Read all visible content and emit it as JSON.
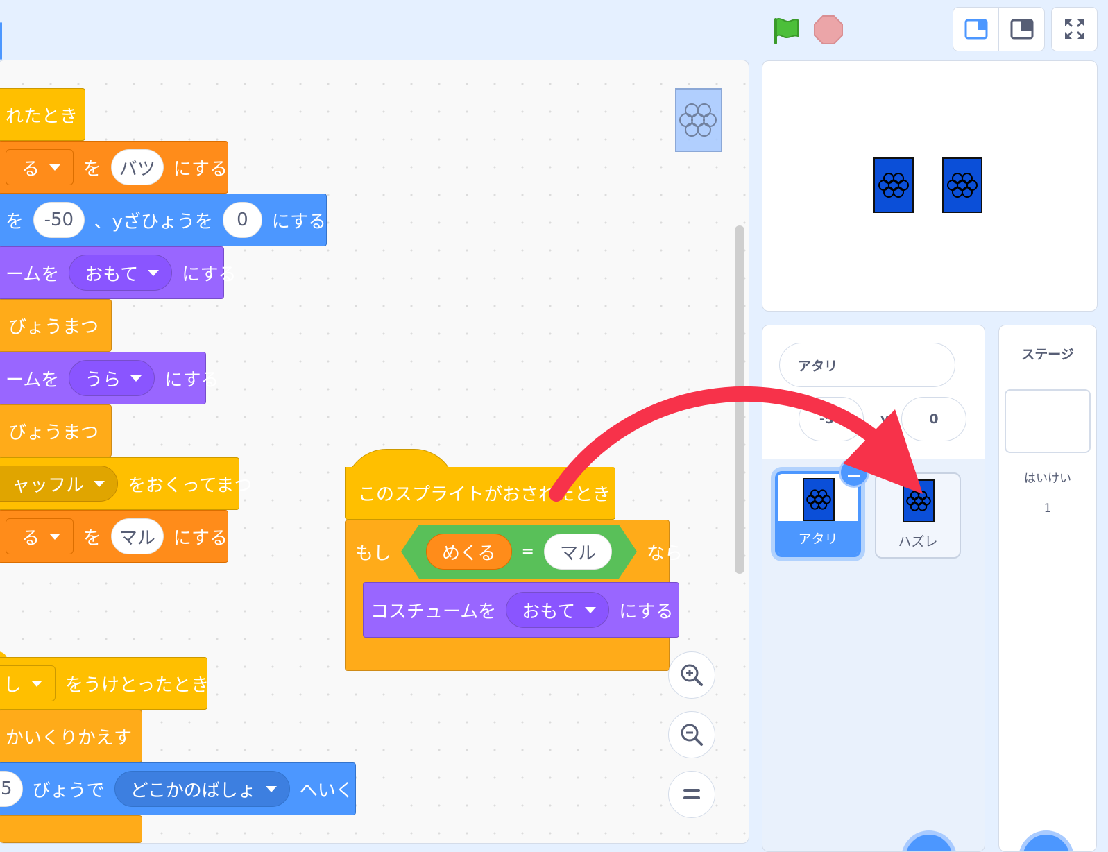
{
  "topbar": {
    "green_flag_icon": "green-flag-icon",
    "stop_icon": "stop-icon",
    "layout_buttons": [
      "small-stage-icon",
      "large-stage-icon"
    ],
    "fullscreen_icon": "fullscreen-icon"
  },
  "scripts": {
    "s1_hat": "れたとき",
    "s1_set1_dd": "る",
    "s1_set1_wo": "を",
    "s1_set1_val": "バツ",
    "s1_set1_suffix": "にする",
    "s1_goto_prefix": "を",
    "s1_goto_x": "-50",
    "s1_goto_mid": "、yざひょうを",
    "s1_goto_y": "0",
    "s1_goto_suffix": "にする",
    "s1_costume1_prefix": "ームを",
    "s1_costume1_dd": "おもて",
    "s1_costume1_suffix": "にする",
    "s1_wait1": "びょうまつ",
    "s1_costume2_prefix": "ームを",
    "s1_costume2_dd": "うら",
    "s1_costume2_suffix": "にする",
    "s1_wait2": "びょうまつ",
    "s1_broadcast_dd": "ャッフル",
    "s1_broadcast_suffix": "をおくってまつ",
    "s1_set2_dd": "る",
    "s1_set2_wo": "を",
    "s1_set2_val": "マル",
    "s1_set2_suffix": "にする",
    "s2_hat_dd": "し",
    "s2_hat_suffix": "をうけとったとき",
    "s2_repeat": "かいくりかえす",
    "s2_glide_val": "5",
    "s2_glide_mid": "びょうで",
    "s2_glide_dd": "どこかのばしょ",
    "s2_glide_suffix": "へいく",
    "s3_hat": "このスプライトがおされたとき",
    "s3_if": "もし",
    "s3_var": "めくる",
    "s3_eq": "=",
    "s3_val": "マル",
    "s3_then": "なら",
    "s3_costume_prefix": "コスチュームを",
    "s3_costume_dd": "おもて",
    "s3_costume_suffix": "にする"
  },
  "zoom": [
    "zoom-in-icon",
    "zoom-out-icon",
    "zoom-reset-icon"
  ],
  "sprite_info": {
    "name": "アタリ",
    "x": "-50",
    "y_label": "y",
    "y": "0"
  },
  "sprites": [
    {
      "name": "アタリ",
      "selected": true
    },
    {
      "name": "ハズレ",
      "selected": false
    }
  ],
  "stage_panel": {
    "title": "ステージ",
    "backdrops_label": "はいけい",
    "backdrops_count": "1"
  },
  "colors": {
    "events": "#ffbf00",
    "control": "#ffab19",
    "variables": "#ff8c1a",
    "motion": "#4c97ff",
    "looks": "#9966ff",
    "operators": "#59c059",
    "annotation_arrow": "#f7324a"
  }
}
